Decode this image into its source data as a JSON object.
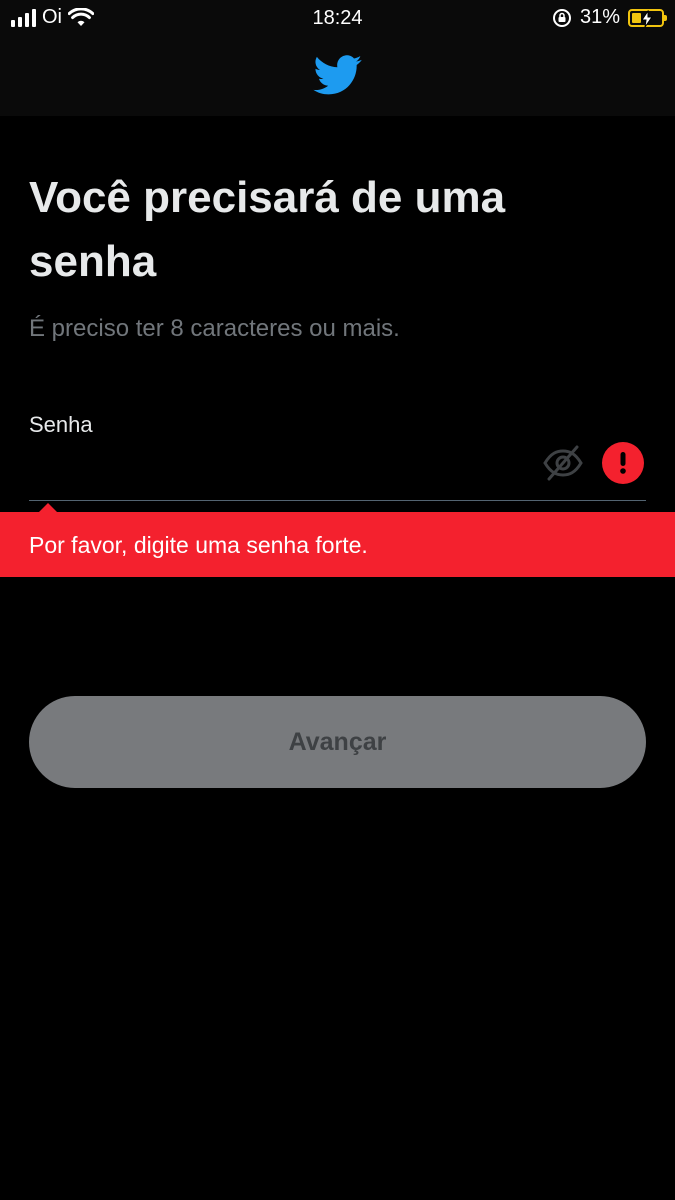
{
  "status_bar": {
    "carrier": "Oi",
    "time": "18:24",
    "battery_percent": "31%",
    "battery_level": 0.31,
    "signal_icon": "cellular-signal-icon",
    "wifi_icon": "wifi-icon",
    "lock_icon": "rotation-lock-icon",
    "battery_icon": "battery-charging-icon"
  },
  "header": {
    "logo_icon": "twitter-bird-icon",
    "logo_color": "#1d9bf0"
  },
  "main": {
    "title": "Você precisará de uma senha",
    "subtitle": "É preciso ter 8 caracteres ou mais.",
    "password_field": {
      "label": "Senha",
      "value": "",
      "placeholder": "",
      "toggle_icon": "eye-off-icon",
      "error_icon": "exclamation-icon"
    },
    "error": {
      "message": "Por favor, digite uma senha forte.",
      "color": "#f4212e"
    },
    "next_button": {
      "label": "Avançar",
      "state": "disabled"
    }
  }
}
